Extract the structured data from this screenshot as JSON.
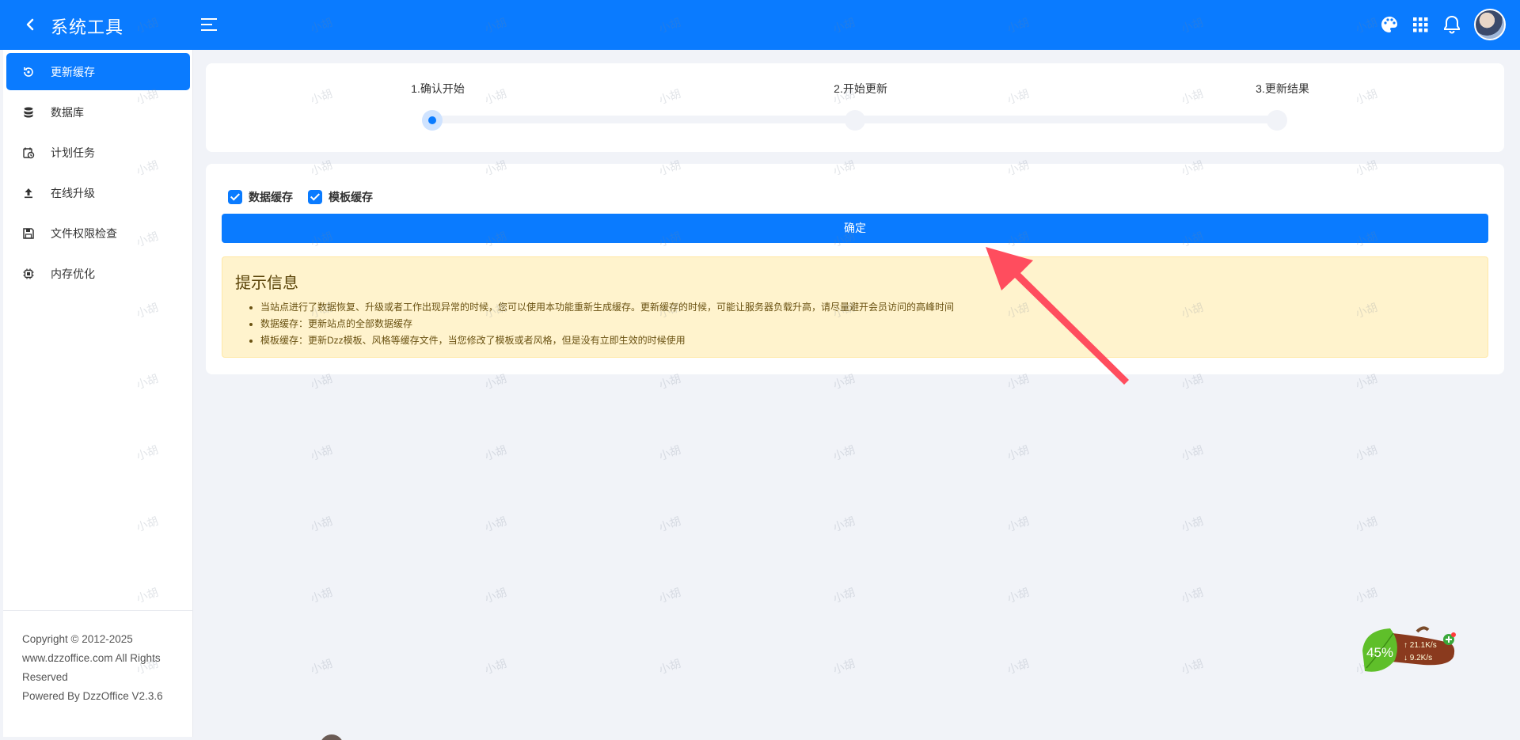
{
  "header": {
    "title": "系统工具",
    "watermark_text": "小胡"
  },
  "sidebar": {
    "items": [
      {
        "label": "更新缓存",
        "icon": "refresh-icon",
        "active": true
      },
      {
        "label": "数据库",
        "icon": "database-icon",
        "active": false
      },
      {
        "label": "计划任务",
        "icon": "schedule-icon",
        "active": false
      },
      {
        "label": "在线升级",
        "icon": "upload-icon",
        "active": false
      },
      {
        "label": "文件权限检查",
        "icon": "save-icon",
        "active": false
      },
      {
        "label": "内存优化",
        "icon": "chip-icon",
        "active": false
      }
    ],
    "footer": {
      "line1": "Copyright © 2012-2025",
      "line2": "www.dzzoffice.com All Rights",
      "line3": "Reserved",
      "line4": "Powered By DzzOffice V2.3.6"
    }
  },
  "steps": [
    {
      "label": "1.确认开始",
      "active": true
    },
    {
      "label": "2.开始更新",
      "active": false
    },
    {
      "label": "3.更新结果",
      "active": false
    }
  ],
  "options": [
    {
      "label": "数据缓存",
      "checked": true
    },
    {
      "label": "模板缓存",
      "checked": true
    }
  ],
  "confirm_label": "确定",
  "tips": {
    "title": "提示信息",
    "items": [
      "当站点进行了数据恢复、升级或者工作出现异常的时候，您可以使用本功能重新生成缓存。更新缓存的时候，可能让服务器负载升高，请尽量避开会员访问的高峰时间",
      "数据缓存：更新站点的全部数据缓存",
      "模板缓存：更新Dzz模板、风格等缓存文件，当您修改了模板或者风格，但是没有立即生效的时候使用"
    ]
  },
  "net_widget": {
    "percent": "45%",
    "up": "21.1K/s",
    "down": "9.2K/s"
  },
  "colors": {
    "primary": "#0a7bff",
    "tips_bg": "#fff3cd",
    "arrow": "#ff4d5e"
  }
}
